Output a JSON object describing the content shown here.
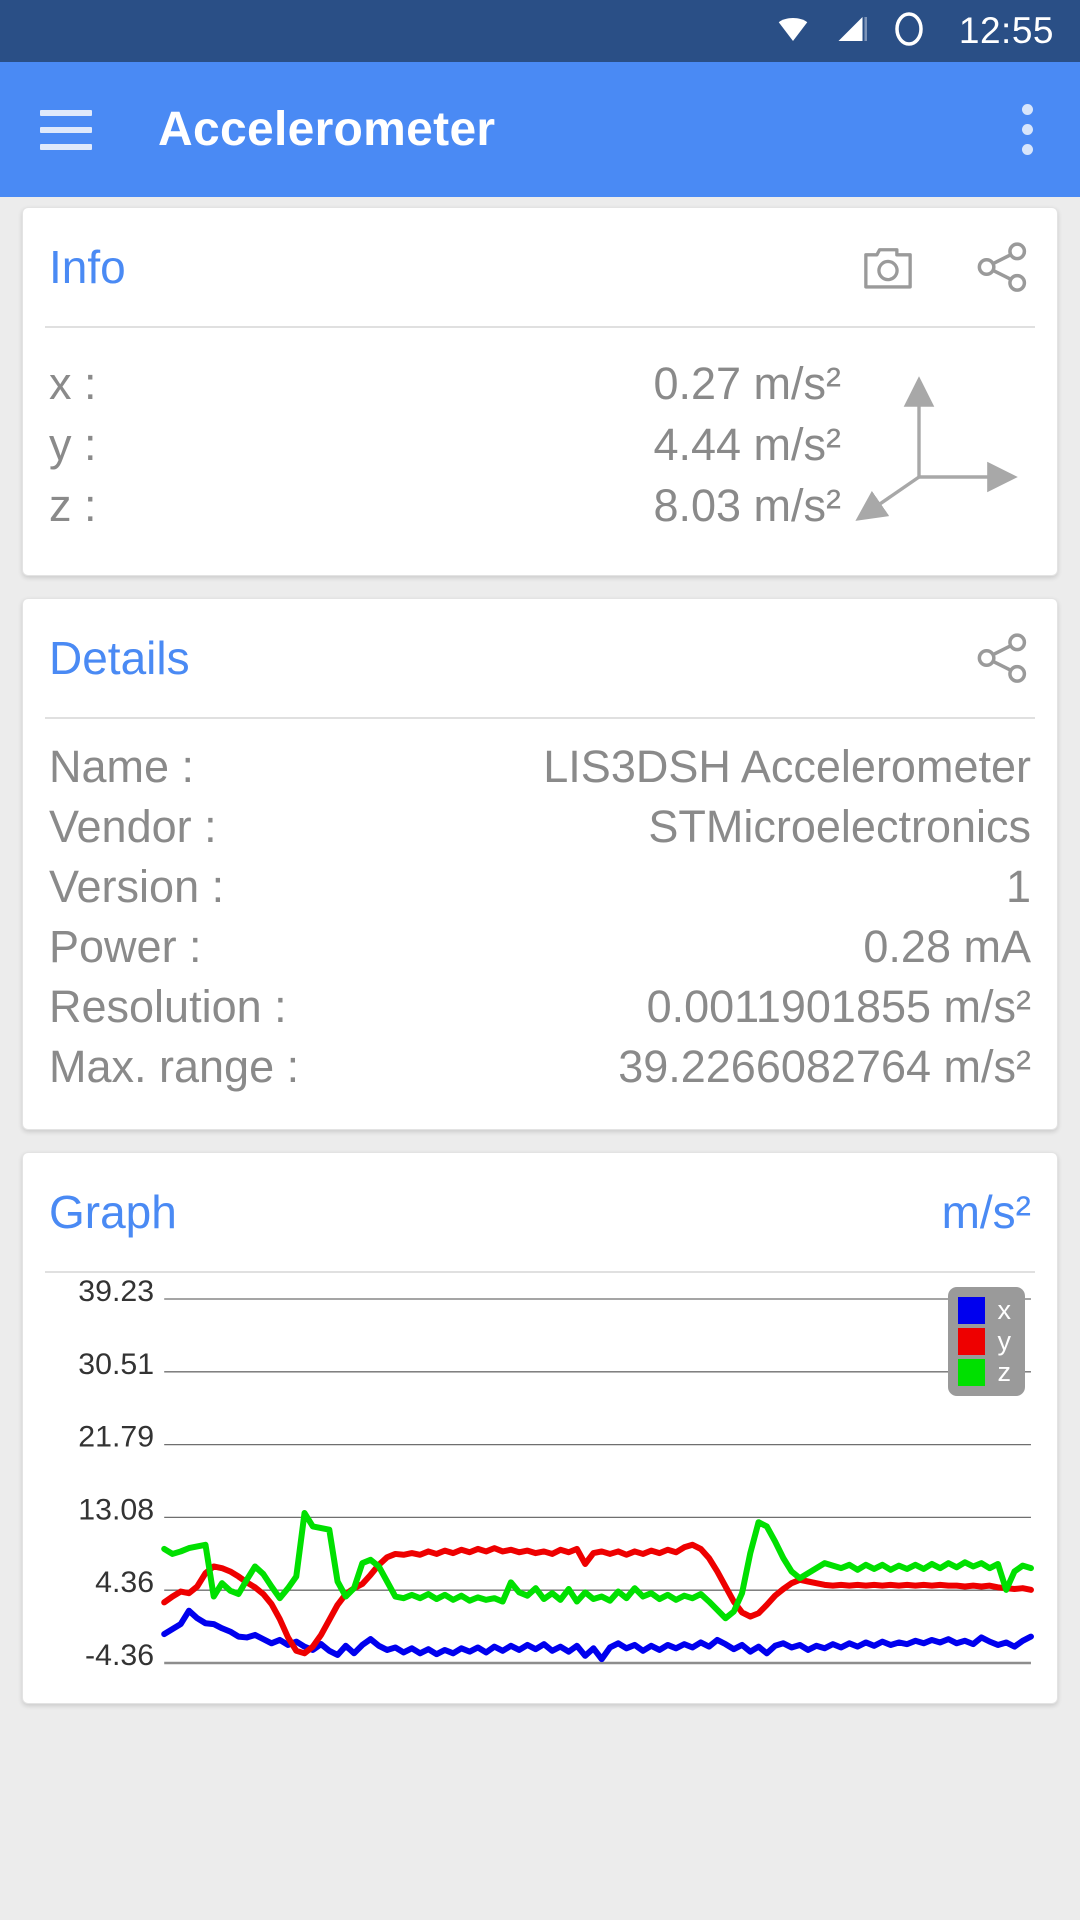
{
  "statusbar": {
    "time": "12:55",
    "icons": [
      "wifi-icon",
      "signal-icon",
      "circle-icon"
    ]
  },
  "appbar": {
    "title": "Accelerometer",
    "menu_icon": "hamburger-menu-icon",
    "overflow_icon": "overflow-menu-icon"
  },
  "info_card": {
    "title": "Info",
    "camera_icon": "camera-icon",
    "share_icon": "share-icon",
    "axes_icon": "xyz-axes-icon",
    "rows": [
      {
        "label": "x :",
        "value": "0.27 m/s²"
      },
      {
        "label": "y :",
        "value": "4.44 m/s²"
      },
      {
        "label": "z :",
        "value": "8.03 m/s²"
      }
    ]
  },
  "details_card": {
    "title": "Details",
    "share_icon": "share-icon",
    "rows": [
      {
        "label": "Name :",
        "value": "LIS3DSH Accelerometer"
      },
      {
        "label": "Vendor :",
        "value": "STMicroelectronics"
      },
      {
        "label": "Version :",
        "value": "1"
      },
      {
        "label": "Power :",
        "value": "0.28 mA"
      },
      {
        "label": "Resolution :",
        "value": "0.0011901855 m/s²"
      },
      {
        "label": "Max. range :",
        "value": "39.2266082764 m/s²"
      }
    ]
  },
  "graph_card": {
    "title": "Graph",
    "unit": "m/s²"
  },
  "chart_data": {
    "type": "line",
    "title": "Graph",
    "ylabel": "m/s²",
    "xlabel": "",
    "grid": true,
    "legend_position": "top-right",
    "ylim": [
      -4.36,
      39.23
    ],
    "yticks": [
      39.23,
      30.51,
      21.79,
      13.08,
      4.36,
      -4.36
    ],
    "ytick_labels": [
      "39.23",
      "30.51",
      "21.79",
      "13.08",
      "4.36",
      "-4.36"
    ],
    "colors": {
      "x": "#0000ee",
      "y": "#ee0000",
      "z": "#00e000"
    },
    "legend": [
      "x",
      "y",
      "z"
    ],
    "series": [
      {
        "name": "x",
        "color": "#0000ee",
        "values": [
          -0.9,
          -0.3,
          0.3,
          1.9,
          1.0,
          0.4,
          0.3,
          -0.2,
          -0.6,
          -1.2,
          -1.3,
          -1.0,
          -1.5,
          -2.0,
          -1.6,
          -2.2,
          -1.8,
          -2.4,
          -2.8,
          -2.1,
          -2.9,
          -3.4,
          -2.3,
          -3.2,
          -2.2,
          -1.5,
          -2.3,
          -2.8,
          -2.5,
          -3.1,
          -2.6,
          -3.2,
          -2.7,
          -3.3,
          -2.8,
          -3.2,
          -2.6,
          -3.0,
          -2.5,
          -3.1,
          -2.4,
          -2.9,
          -2.3,
          -2.8,
          -2.2,
          -2.7,
          -2.1,
          -2.9,
          -2.4,
          -3.0,
          -2.3,
          -3.5,
          -2.6,
          -3.9,
          -2.5,
          -2.0,
          -2.6,
          -2.2,
          -2.9,
          -2.3,
          -2.8,
          -2.2,
          -2.6,
          -2.1,
          -2.5,
          -1.9,
          -2.4,
          -1.6,
          -2.1,
          -2.7,
          -2.2,
          -3.0,
          -2.4,
          -3.2,
          -2.3,
          -2.0,
          -2.5,
          -2.2,
          -2.8,
          -2.3,
          -2.6,
          -2.1,
          -2.5,
          -2.0,
          -2.4,
          -1.9,
          -2.3,
          -1.8,
          -2.2,
          -1.9,
          -2.1,
          -1.7,
          -2.0,
          -1.6,
          -1.9,
          -1.5,
          -2.0,
          -1.7,
          -2.1,
          -1.3,
          -1.8,
          -2.2,
          -1.9,
          -2.4,
          -1.7,
          -1.2
        ]
      },
      {
        "name": "y",
        "color": "#ee0000",
        "values": [
          2.9,
          3.6,
          4.2,
          4.0,
          4.8,
          6.4,
          7.2,
          7.0,
          6.6,
          6.0,
          5.3,
          4.7,
          3.9,
          2.7,
          0.9,
          -1.3,
          -2.9,
          -3.2,
          -2.4,
          -1.0,
          0.8,
          2.6,
          3.9,
          4.6,
          5.1,
          6.2,
          7.4,
          8.3,
          8.7,
          8.6,
          8.8,
          8.6,
          9.0,
          8.7,
          9.1,
          8.8,
          9.2,
          8.9,
          9.3,
          9.0,
          9.4,
          9.0,
          9.2,
          8.9,
          9.1,
          8.8,
          9.0,
          8.7,
          9.2,
          8.9,
          9.3,
          7.5,
          8.8,
          9.0,
          8.7,
          9.0,
          8.6,
          9.0,
          8.7,
          9.1,
          8.8,
          9.2,
          8.9,
          9.5,
          9.8,
          9.3,
          8.2,
          6.6,
          4.8,
          3.0,
          1.7,
          1.2,
          1.6,
          2.6,
          3.7,
          4.5,
          5.2,
          5.6,
          5.4,
          5.2,
          5.0,
          4.9,
          5.0,
          4.9,
          5.0,
          4.9,
          5.0,
          4.9,
          5.0,
          4.9,
          5.0,
          4.9,
          5.0,
          4.9,
          5.0,
          4.9,
          4.9,
          4.8,
          4.9,
          4.8,
          4.9,
          4.7,
          4.6,
          4.5,
          4.6,
          4.4
        ]
      },
      {
        "name": "z",
        "color": "#00e000",
        "values": [
          9.3,
          8.7,
          9.0,
          9.4,
          9.6,
          9.8,
          3.6,
          5.2,
          4.3,
          3.9,
          5.6,
          7.2,
          6.3,
          4.8,
          3.4,
          4.6,
          6.0,
          13.6,
          12.0,
          11.8,
          11.6,
          5.4,
          3.6,
          4.6,
          7.6,
          8.0,
          7.2,
          5.4,
          3.6,
          3.4,
          3.8,
          3.4,
          3.9,
          3.3,
          3.8,
          3.2,
          3.7,
          3.1,
          3.5,
          3.2,
          3.4,
          3.0,
          5.3,
          4.1,
          3.7,
          4.6,
          3.3,
          4.0,
          3.2,
          4.5,
          3.0,
          4.1,
          3.3,
          3.6,
          3.1,
          4.2,
          3.4,
          4.6,
          3.6,
          4.0,
          3.3,
          3.8,
          3.2,
          3.7,
          3.4,
          3.9,
          3.0,
          2.0,
          1.0,
          1.8,
          4.0,
          8.8,
          12.5,
          12.0,
          10.2,
          8.2,
          6.6,
          5.8,
          6.4,
          7.0,
          7.6,
          7.3,
          7.0,
          7.4,
          6.8,
          7.4,
          6.9,
          7.4,
          6.8,
          7.3,
          6.9,
          7.4,
          6.9,
          7.5,
          7.0,
          7.6,
          7.1,
          7.7,
          7.2,
          7.6,
          7.0,
          7.5,
          4.4,
          6.6,
          7.3,
          7.0
        ]
      }
    ]
  }
}
